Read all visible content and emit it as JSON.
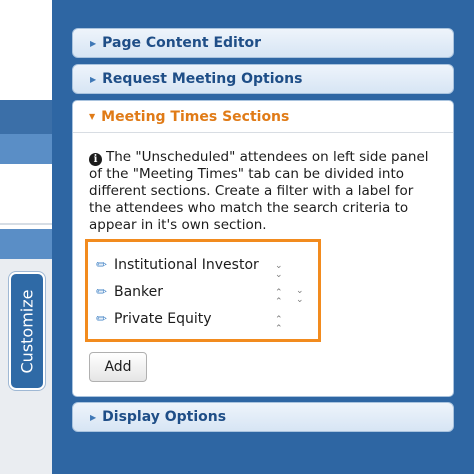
{
  "left": {
    "customize_label": "Customize"
  },
  "accordion": {
    "page_content_editor": "Page Content Editor",
    "request_meeting_options": "Request Meeting Options",
    "meeting_times_sections": "Meeting Times Sections",
    "display_options": "Display Options"
  },
  "meeting_times": {
    "info_text": "The \"Unscheduled\" attendees on left side panel of the \"Meeting Times\" tab can be divided into different sections. Create a filter with a label for the attendees who match the search criteria to appear in it's own section.",
    "filters": [
      {
        "label": "Institutional Investor",
        "controls": [
          "move-down"
        ]
      },
      {
        "label": "Banker",
        "controls": [
          "move-up",
          "move-down"
        ]
      },
      {
        "label": "Private Equity",
        "controls": [
          "move-up"
        ]
      }
    ],
    "add_label": "Add"
  },
  "colors": {
    "panel_blue": "#2e66a3",
    "header_text": "#1f4e87",
    "active_header": "#e07b17",
    "highlight_border": "#f28b1e"
  },
  "icons": {
    "collapsed": "triangle-right-icon",
    "expanded": "triangle-down-icon",
    "edit": "pencil-icon",
    "info": "info-icon",
    "move_up": "chevron-double-up-icon",
    "move_down": "chevron-double-down-icon"
  }
}
